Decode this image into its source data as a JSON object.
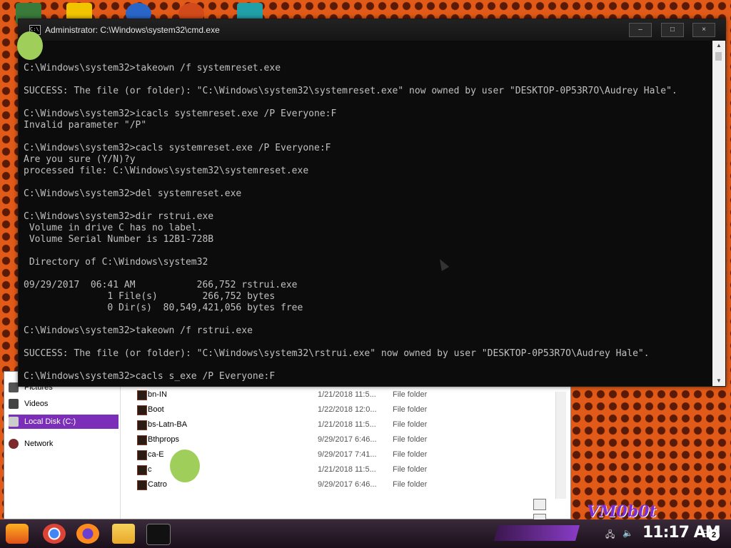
{
  "cmd": {
    "title": "Administrator: C:\\Windows\\system32\\cmd.exe",
    "lines": [
      "C:\\Windows\\system32>takeown /f systemreset.exe",
      "",
      "SUCCESS: The file (or folder): \"C:\\Windows\\system32\\systemreset.exe\" now owned by user \"DESKTOP-0P53R7O\\Audrey Hale\".",
      "",
      "C:\\Windows\\system32>icacls systemreset.exe /P Everyone:F",
      "Invalid parameter \"/P\"",
      "",
      "C:\\Windows\\system32>cacls systemreset.exe /P Everyone:F",
      "Are you sure (Y/N)?y",
      "processed file: C:\\Windows\\system32\\systemreset.exe",
      "",
      "C:\\Windows\\system32>del systemreset.exe",
      "",
      "C:\\Windows\\system32>dir rstrui.exe",
      " Volume in drive C has no label.",
      " Volume Serial Number is 12B1-728B",
      "",
      " Directory of C:\\Windows\\system32",
      "",
      "09/29/2017  06:41 AM           266,752 rstrui.exe",
      "               1 File(s)        266,752 bytes",
      "               0 Dir(s)  80,549,421,056 bytes free",
      "",
      "C:\\Windows\\system32>takeown /f rstrui.exe",
      "",
      "SUCCESS: The file (or folder): \"C:\\Windows\\system32\\rstrui.exe\" now owned by user \"DESKTOP-0P53R7O\\Audrey Hale\".",
      "",
      "C:\\Windows\\system32>cacls s_exe /P Everyone:F"
    ],
    "buttons": {
      "minimize": "–",
      "maximize": "□",
      "close": "×"
    }
  },
  "explorer": {
    "nav": [
      {
        "label": "Pictures",
        "icon": "pictures-icon"
      },
      {
        "label": "Videos",
        "icon": "videos-icon"
      },
      {
        "label": "Local Disk (C:)",
        "icon": "drive-icon",
        "selected": true
      },
      {
        "label": "Network",
        "icon": "network-icon"
      }
    ],
    "files": [
      {
        "name": "bn-IN",
        "date": "1/21/2018 11:5...",
        "type": "File folder"
      },
      {
        "name": "Boot",
        "date": "1/22/2018 12:0...",
        "type": "File folder"
      },
      {
        "name": "bs-Latn-BA",
        "date": "1/21/2018 11:5...",
        "type": "File folder"
      },
      {
        "name": "Bthprops",
        "date": "9/29/2017 6:46...",
        "type": "File folder"
      },
      {
        "name": "ca-E",
        "date": "9/29/2017 7:41...",
        "type": "File folder"
      },
      {
        "name": "c",
        "date": "1/21/2018 11:5...",
        "type": "File folder"
      },
      {
        "name": "Catro",
        "date": "9/29/2017 6:46...",
        "type": "File folder"
      }
    ]
  },
  "taskbar": {
    "clock": "11:17 AM",
    "notification_count": "2",
    "apps": [
      "start-icon",
      "chrome-icon",
      "firefox-icon",
      "file-explorer-icon",
      "cmd-icon"
    ]
  },
  "wallpaper": {
    "logo_text": "VM0b0t"
  },
  "colors": {
    "accent": "#7b2fb8",
    "console_bg": "#0c0c0c",
    "console_fg": "#c0c0c0",
    "wallpaper": "#e15a17"
  }
}
